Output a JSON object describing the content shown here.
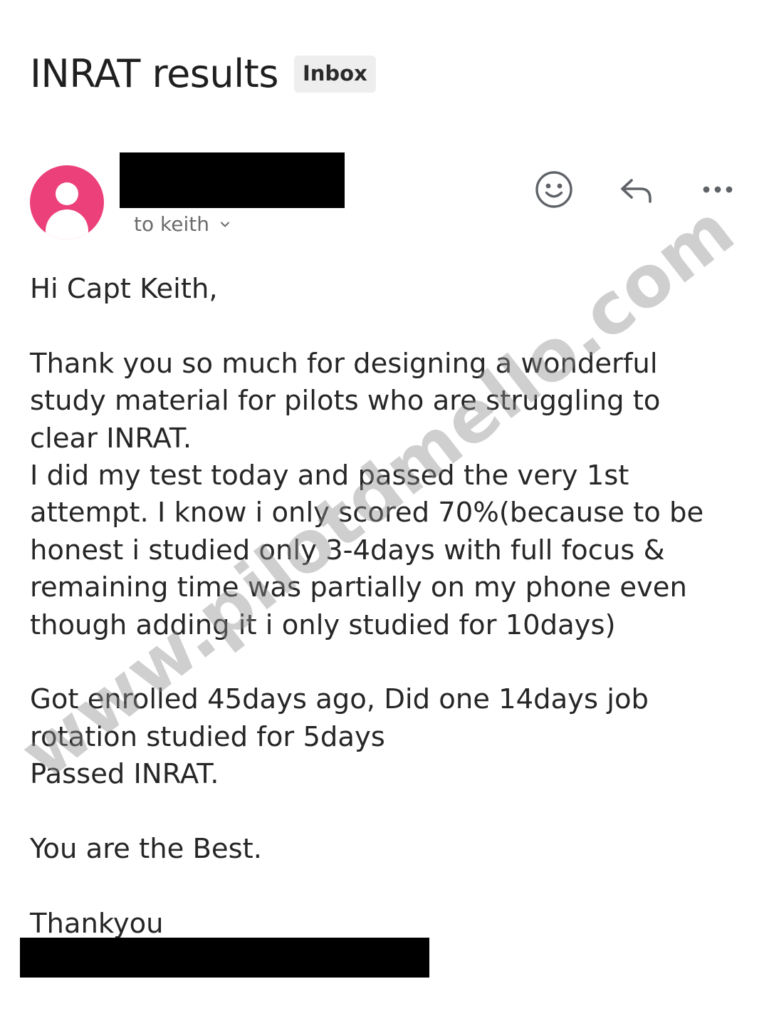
{
  "email": {
    "subject": "INRAT results",
    "label": "Inbox",
    "recipient_text": "to keith",
    "body": {
      "greeting": "Hi Capt Keith,",
      "paragraph1": "Thank you so much for designing a wonderful\nstudy material for pilots who are struggling to\nclear INRAT.\nI did my test today and passed the very 1st\nattempt. I know i only scored 70%(because to be\nhonest i studied only 3-4days with full focus &\nremaining time was partially on my phone even\nthough adding it i  only studied for 10days)",
      "paragraph2": "Got enrolled 45days ago, Did one 14days job\nrotation studied for 5days\nPassed INRAT.",
      "paragraph3": "You are the Best.",
      "closing": "Thankyou"
    }
  },
  "watermark": "www.pilotdmello.com",
  "icons": {
    "avatar": "person-avatar",
    "emoji": "smiley-face-icon",
    "reply": "reply-arrow-icon",
    "more": "more-dots-icon",
    "recipient_expand": "chevron-down-icon"
  },
  "colors": {
    "avatar_bg": "#ec407a",
    "text": "#262626",
    "muted": "#6b6b6b",
    "badge_bg": "#eeeeee",
    "icon": "#5f6368",
    "redaction": "#000000"
  }
}
